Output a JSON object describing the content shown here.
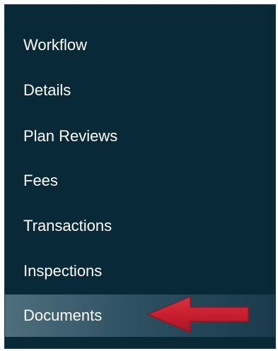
{
  "sidebar": {
    "items": [
      {
        "label": "Workflow",
        "active": false
      },
      {
        "label": "Details",
        "active": false
      },
      {
        "label": "Plan Reviews",
        "active": false
      },
      {
        "label": "Fees",
        "active": false
      },
      {
        "label": "Transactions",
        "active": false
      },
      {
        "label": "Inspections",
        "active": false
      },
      {
        "label": "Documents",
        "active": true
      }
    ]
  },
  "colors": {
    "sidebar_bg": "#082a38",
    "active_bg": "#3d5f6e",
    "text": "#ffffff",
    "arrow": "#c8202f"
  },
  "annotation": {
    "icon": "red-arrow-pointing-left"
  }
}
